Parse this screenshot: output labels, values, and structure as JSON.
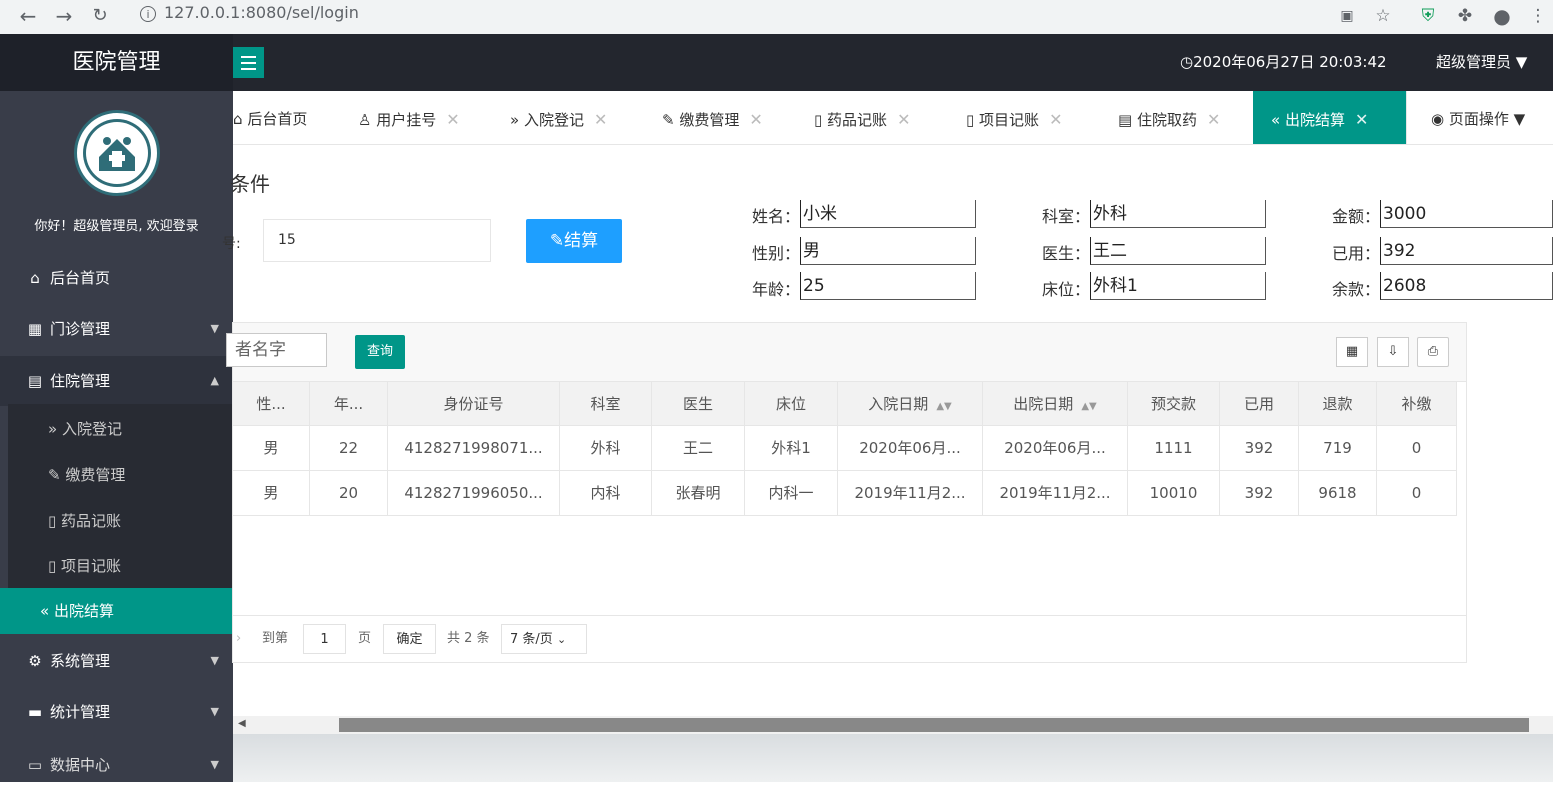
{
  "browser": {
    "url": "127.0.0.1:8080/sel/login",
    "icons": [
      "back-icon",
      "forward-icon",
      "reload-icon",
      "info-icon",
      "translate-icon",
      "star-icon",
      "shield-icon",
      "puzzle-icon",
      "account-icon",
      "more-icon"
    ]
  },
  "header": {
    "app_title": "医院管理",
    "datetime": "2020年06月27日 20:03:42",
    "user_menu": "超级管理员",
    "clock_icon": "◷"
  },
  "sidebar": {
    "welcome": "你好！超级管理员, 欢迎登录",
    "items": [
      {
        "label": "后台首页",
        "icon": "⌂"
      },
      {
        "label": "门诊管理",
        "icon": "▦"
      },
      {
        "label": "住院管理",
        "icon": "▤"
      },
      {
        "label": "系统管理",
        "icon": "⚙"
      },
      {
        "label": "统计管理",
        "icon": "▬"
      },
      {
        "label": "数据中心",
        "icon": "▭"
      }
    ],
    "sub_items": [
      {
        "label": "入院登记",
        "icon": "»"
      },
      {
        "label": "缴费管理",
        "icon": "✎"
      },
      {
        "label": "药品记账",
        "icon": "▯"
      },
      {
        "label": "项目记账",
        "icon": "▯"
      },
      {
        "label": "出院结算",
        "icon": "«"
      }
    ]
  },
  "tabs": [
    {
      "label": "后台首页",
      "icon": "⌂"
    },
    {
      "label": "用户挂号",
      "icon": "♙"
    },
    {
      "label": "入院登记",
      "icon": "»"
    },
    {
      "label": "缴费管理",
      "icon": "✎"
    },
    {
      "label": "药品记账",
      "icon": "▯"
    },
    {
      "label": "项目记账",
      "icon": "▯"
    },
    {
      "label": "住院取药",
      "icon": "▤"
    },
    {
      "label": "出院结算",
      "icon": "«"
    },
    {
      "label": "页面操作",
      "icon": "◉"
    }
  ],
  "form": {
    "section_title": "条件",
    "search_label": "号:",
    "search_value": "15",
    "settle_button": "结算",
    "fields": [
      {
        "label": "姓名：",
        "value": "小米"
      },
      {
        "label": "性别：",
        "value": "男"
      },
      {
        "label": "年龄：",
        "value": "25"
      },
      {
        "label": "科室：",
        "value": "外科"
      },
      {
        "label": "医生：",
        "value": "王二"
      },
      {
        "label": "床位：",
        "value": "外科1"
      },
      {
        "label": "金额：",
        "value": "3000"
      },
      {
        "label": "已用：",
        "value": "392"
      },
      {
        "label": "余款：",
        "value": "2608"
      }
    ]
  },
  "table": {
    "name_placeholder": "者名字",
    "query_button": "查询",
    "tool_icons": [
      "columns-icon",
      "export-icon",
      "print-icon"
    ],
    "columns": [
      "性...",
      "年...",
      "身份证号",
      "科室",
      "医生",
      "床位",
      "入院日期",
      "出院日期",
      "预交款",
      "已用",
      "退款",
      "补缴"
    ],
    "rows": [
      [
        "男",
        "22",
        "4128271998071...",
        "外科",
        "王二",
        "外科1",
        "2020年06月...",
        "2020年06月...",
        "1111",
        "392",
        "719",
        "0"
      ],
      [
        "男",
        "20",
        "4128271996050...",
        "内科",
        "张春明",
        "内科一",
        "2019年11月2...",
        "2019年11月2...",
        "10010",
        "392",
        "9618",
        "0"
      ]
    ]
  },
  "pager": {
    "goto_label": "到第",
    "page_value": "1",
    "page_unit": "页",
    "confirm": "确定",
    "total": "共 2 条",
    "per_page": "7 条/页"
  },
  "colors": {
    "accent": "#009688",
    "sidebar_bg": "#393d49",
    "header_bg": "#23262e",
    "blue_button": "#1e9fff"
  }
}
